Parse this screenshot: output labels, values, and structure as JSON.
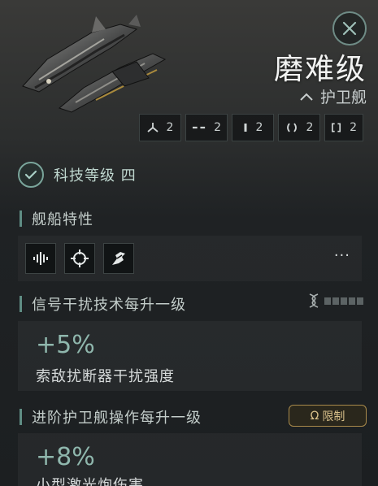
{
  "ship": {
    "name": "磨难级",
    "class": "护卫舰"
  },
  "slots": [
    {
      "icon": "turret-hardpoint-icon",
      "value": "2"
    },
    {
      "icon": "launcher-hardpoint-icon",
      "value": "2"
    },
    {
      "icon": "high-slot-icon",
      "value": "2"
    },
    {
      "icon": "mid-slot-icon",
      "value": "2"
    },
    {
      "icon": "low-slot-icon",
      "value": "2"
    }
  ],
  "tech": {
    "label": "科技等级 四"
  },
  "traits_section": {
    "title": "舰船特性"
  },
  "traits": {
    "more": "···"
  },
  "bonus_1": {
    "title": "信号干扰技术每升一级",
    "value": "+5%",
    "desc": "索敌扰断器干扰强度",
    "skill_level": 0
  },
  "bonus_2": {
    "title": "进阶护卫舰操作每升一级",
    "restrict_label": "限制",
    "value": "+8%",
    "desc": "小型激光炮伤害"
  },
  "colors": {
    "accent": "#5f8d84",
    "value_green": "#8fb7ad",
    "restrict_gold": "#a98a4b"
  }
}
